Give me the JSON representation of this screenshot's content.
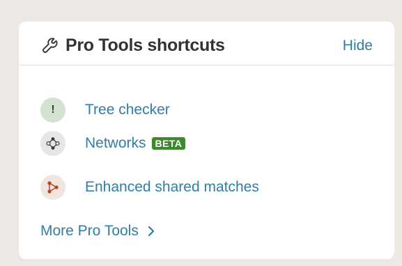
{
  "header": {
    "title": "Pro Tools shortcuts",
    "hide_label": "Hide",
    "icon": "wrench-icon"
  },
  "tools": [
    {
      "label": "Tree checker",
      "icon": "exclamation-icon",
      "icon_glyph": "!"
    },
    {
      "label": "Networks",
      "icon": "network-nodes-icon",
      "badge": "BETA"
    },
    {
      "label": "Enhanced shared matches",
      "icon": "shared-matches-icon"
    }
  ],
  "more": {
    "label": "More Pro Tools",
    "icon": "chevron-right-icon"
  },
  "colors": {
    "background": "#ece8e3",
    "card": "#ffffff",
    "link": "#2f7ea6",
    "title": "#333333",
    "beta_badge": "#3d8a2c",
    "tree_icon_bg": "#d4e3d1",
    "network_icon_bg": "#e8e6e4",
    "esm_icon_bg": "#f1e6df",
    "esm_accent": "#b8452a"
  }
}
